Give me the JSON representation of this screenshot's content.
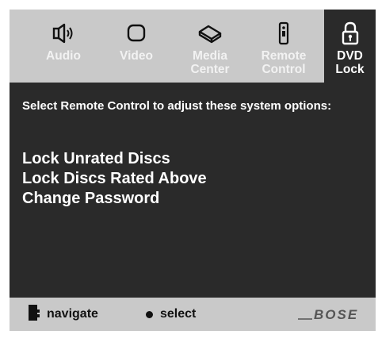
{
  "tabs": [
    {
      "label_line1": "Audio",
      "label_line2": "",
      "icon": "speaker-icon",
      "active": false
    },
    {
      "label_line1": "Video",
      "label_line2": "",
      "icon": "tv-screen-icon",
      "active": false
    },
    {
      "label_line1": "Media",
      "label_line2": "Center",
      "icon": "media-center-icon",
      "active": false
    },
    {
      "label_line1": "Remote",
      "label_line2": "Control",
      "icon": "remote-control-icon",
      "active": false
    },
    {
      "label_line1": "DVD",
      "label_line2": "Lock",
      "icon": "padlock-icon",
      "active": true
    }
  ],
  "panel": {
    "prompt": "Select Remote Control to adjust these system options:",
    "menu": [
      "Lock Unrated Discs",
      "Lock Discs Rated Above",
      "Change Password"
    ]
  },
  "footer": {
    "navigate_label": "navigate",
    "select_label": "select",
    "brand": "BOSE"
  },
  "colors": {
    "frame_gray": "#c9c9c9",
    "panel_dark": "#2a2a2a",
    "text_white": "#ffffff",
    "footer_text": "#111111"
  }
}
